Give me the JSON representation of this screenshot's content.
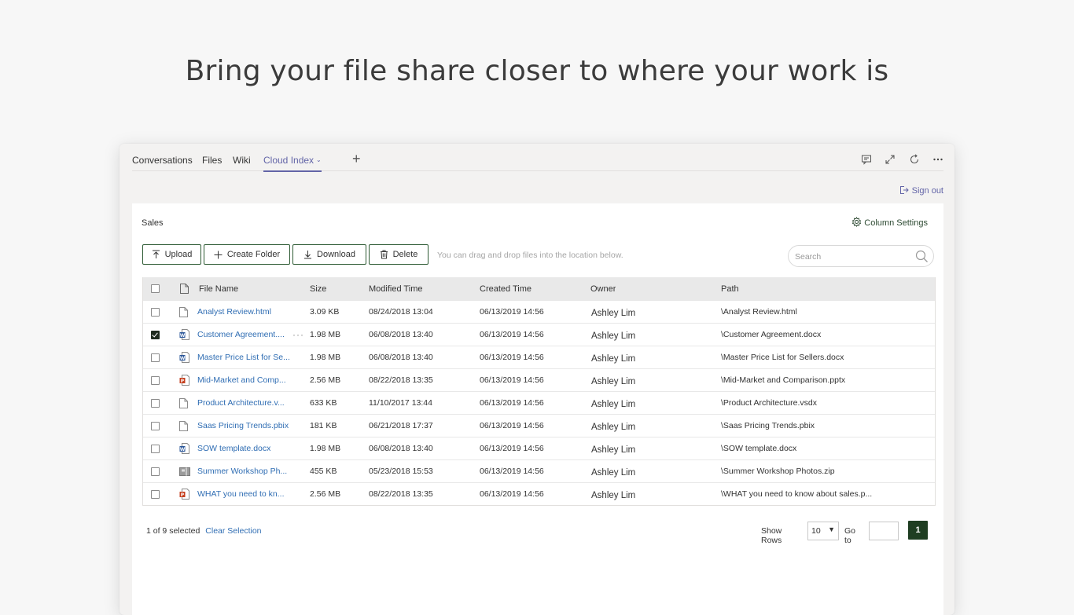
{
  "headline": "Bring your file share closer to where your work is",
  "tabs": [
    {
      "label": "Conversations"
    },
    {
      "label": "Files"
    },
    {
      "label": "Wiki"
    },
    {
      "label": "Cloud Index",
      "active": true
    }
  ],
  "window_icons": [
    "chat-icon",
    "expand-icon",
    "refresh-icon",
    "more-icon"
  ],
  "signout_label": "Sign out",
  "breadcrumb": "Sales",
  "column_settings_label": "Column Settings",
  "toolbar": {
    "upload": "Upload",
    "create_folder": "Create Folder",
    "download": "Download",
    "delete": "Delete",
    "hint": "You can drag and drop files into the location below."
  },
  "search": {
    "placeholder": "Search"
  },
  "columns": {
    "file_name": "File Name",
    "size": "Size",
    "modified": "Modified Time",
    "created": "Created Time",
    "owner": "Owner",
    "path": "Path"
  },
  "rows": [
    {
      "name": "Analyst Review.html",
      "type": "file",
      "size": "3.09 KB",
      "modified": "08/24/2018 13:04",
      "created": "06/13/2019 14:56",
      "owner": "Ashley Lim",
      "path": "\\Analyst Review.html",
      "checked": false
    },
    {
      "name": "Customer Agreement....",
      "type": "word",
      "size": "1.98 MB",
      "modified": "06/08/2018 13:40",
      "created": "06/13/2019 14:56",
      "owner": "Ashley Lim",
      "path": "\\Customer Agreement.docx",
      "checked": true,
      "more": "···"
    },
    {
      "name": "Master Price List for Se...",
      "type": "word",
      "size": "1.98 MB",
      "modified": "06/08/2018 13:40",
      "created": "06/13/2019 14:56",
      "owner": "Ashley Lim",
      "path": "\\Master Price List for Sellers.docx",
      "checked": false
    },
    {
      "name": "Mid-Market and Comp...",
      "type": "ppt",
      "size": "2.56 MB",
      "modified": "08/22/2018 13:35",
      "created": "06/13/2019 14:56",
      "owner": "Ashley Lim",
      "path": "\\Mid-Market and Comparison.pptx",
      "checked": false
    },
    {
      "name": "Product Architecture.v...",
      "type": "file",
      "size": "633 KB",
      "modified": "11/10/2017 13:44",
      "created": "06/13/2019 14:56",
      "owner": "Ashley Lim",
      "path": "\\Product Architecture.vsdx",
      "checked": false
    },
    {
      "name": "Saas Pricing Trends.pbix",
      "type": "file",
      "size": "181 KB",
      "modified": "06/21/2018 17:37",
      "created": "06/13/2019 14:56",
      "owner": "Ashley Lim",
      "path": "\\Saas Pricing Trends.pbix",
      "checked": false
    },
    {
      "name": "SOW template.docx",
      "type": "word",
      "size": "1.98 MB",
      "modified": "06/08/2018 13:40",
      "created": "06/13/2019 14:56",
      "owner": "Ashley Lim",
      "path": "\\SOW template.docx",
      "checked": false
    },
    {
      "name": "Summer Workshop Ph...",
      "type": "zip",
      "size": "455 KB",
      "modified": "05/23/2018 15:53",
      "created": "06/13/2019 14:56",
      "owner": "Ashley Lim",
      "path": "\\Summer Workshop Photos.zip",
      "checked": false
    },
    {
      "name": "WHAT you need to kn...",
      "type": "ppt",
      "size": "2.56 MB",
      "modified": "08/22/2018 13:35",
      "created": "06/13/2019 14:56",
      "owner": "Ashley Lim",
      "path": "\\WHAT you need to know about sales.p...",
      "checked": false
    }
  ],
  "footer": {
    "selection": "1 of 9 selected",
    "clear": "Clear Selection",
    "show_rows_label": "Show Rows",
    "show_rows_value": "10",
    "goto_label": "Go to",
    "current_page": "1"
  },
  "colors": {
    "accent": "#6264a7",
    "button_border": "#2d5a33",
    "link": "#2f6db3",
    "page_button": "#1f3e22"
  }
}
